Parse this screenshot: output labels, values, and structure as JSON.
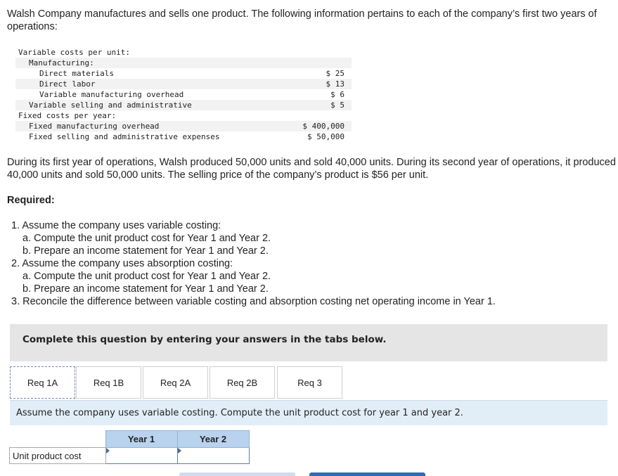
{
  "intro": "Walsh Company manufactures and sells one product. The following information pertains to each of the company’s first two years of operations:",
  "costs": [
    {
      "label": "Variable costs per unit:",
      "indent": 0,
      "value": "",
      "shade": false
    },
    {
      "label": "Manufacturing:",
      "indent": 1,
      "value": "",
      "shade": true
    },
    {
      "label": "Direct materials",
      "indent": 2,
      "value": "$ 25",
      "shade": false
    },
    {
      "label": "Direct labor",
      "indent": 2,
      "value": "$ 13",
      "shade": true
    },
    {
      "label": "Variable manufacturing overhead",
      "indent": 2,
      "value": "$ 6",
      "shade": false
    },
    {
      "label": "Variable selling and administrative",
      "indent": 1,
      "value": "$ 5",
      "shade": true
    },
    {
      "label": "Fixed costs per year:",
      "indent": 0,
      "value": "",
      "shade": false
    },
    {
      "label": "Fixed manufacturing overhead",
      "indent": 1,
      "value": "$ 400,000",
      "shade": true
    },
    {
      "label": "Fixed selling and administrative expenses",
      "indent": 1,
      "value": "$ 50,000",
      "shade": false
    }
  ],
  "paragraph": "During its first year of operations, Walsh produced 50,000 units and sold 40,000 units. During its second year of operations, it produced 40,000 units and sold 50,000 units. The selling price of the company’s product is $56 per unit.",
  "required_heading": "Required:",
  "requirements": [
    {
      "text": "1. Assume the company uses variable costing:",
      "sub": false
    },
    {
      "text": "a. Compute the unit product cost for Year 1 and Year 2.",
      "sub": true
    },
    {
      "text": "b. Prepare an income statement for Year 1 and Year 2.",
      "sub": true
    },
    {
      "text": "2. Assume the company uses absorption costing:",
      "sub": false
    },
    {
      "text": "a. Compute the unit product cost for Year 1 and Year 2.",
      "sub": true
    },
    {
      "text": "b. Prepare an income statement for Year 1 and Year 2.",
      "sub": true
    },
    {
      "text": "3. Reconcile the difference between variable costing and absorption costing net operating income in Year 1.",
      "sub": false
    }
  ],
  "banner": "Complete this question by entering your answers in the tabs below.",
  "tabs": [
    "Req 1A",
    "Req 1B",
    "Req 2A",
    "Req 2B",
    "Req 3"
  ],
  "active_tab": 0,
  "instruction": "Assume the company uses variable costing. Compute the unit product cost for year 1 and year 2.",
  "table": {
    "headers": [
      "Year 1",
      "Year 2"
    ],
    "row_label": "Unit product cost",
    "values": [
      "",
      ""
    ]
  }
}
